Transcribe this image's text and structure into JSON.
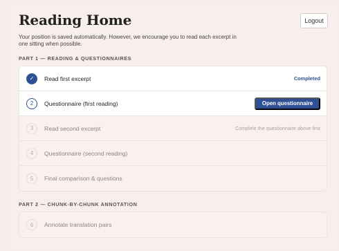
{
  "header": {
    "title": "Reading Home",
    "logout_label": "Logout"
  },
  "intro_text": "Your position is saved automatically. However, we encourage you to read each excerpt in one sitting when possible.",
  "part1": {
    "heading": "PART 1 — READING & QUESTIONNAIRES",
    "steps": [
      {
        "marker": "✓",
        "label": "Read first excerpt",
        "status": "Completed"
      },
      {
        "marker": "2",
        "label": "Questionnaire (first reading)",
        "action": "Open questionnaire"
      },
      {
        "marker": "3",
        "label": "Read second excerpt",
        "hint": "Complete the questionnaire above first"
      },
      {
        "marker": "4",
        "label": "Questionnaire (second reading)"
      },
      {
        "marker": "5",
        "label": "Final comparison & questions"
      }
    ]
  },
  "part2": {
    "heading": "PART 2 — CHUNK-BY-CHUNK ANNOTATION",
    "steps": [
      {
        "marker": "6",
        "label": "Annotate translation pairs"
      }
    ]
  },
  "colors": {
    "accent": "#2d5194",
    "background": "#f7eeec"
  }
}
